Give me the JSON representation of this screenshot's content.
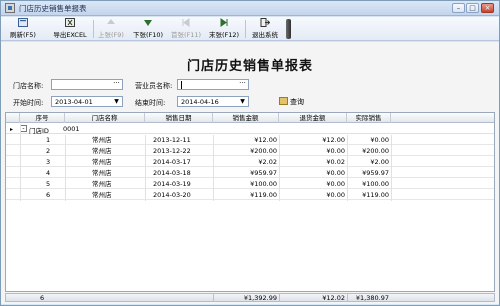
{
  "window": {
    "title": "门店历史销售单报表",
    "minimize": "–",
    "maximize": "□",
    "close": "×"
  },
  "toolbar": {
    "refresh": "刷新(F5)",
    "export_excel": "导出EXCEL",
    "prev_page": "上张(F9)",
    "next_page": "下张(F10)",
    "first_page": "首张(F11)",
    "last_page": "末张(F12)",
    "exit": "退出系统"
  },
  "report": {
    "title": "门店历史销售单报表"
  },
  "filters": {
    "store_label": "门店名称:",
    "store_value": "",
    "clerk_label": "营业员名称:",
    "clerk_value": "",
    "start_label": "开始时间:",
    "start_value": "2013-04-01",
    "end_label": "结束时间:",
    "end_value": "2014-04-16",
    "query_label": "查询",
    "dots": "···",
    "dropdown": "▼"
  },
  "grid": {
    "columns": [
      "序号",
      "门店名称",
      "销售日期",
      "销售金额",
      "退货金额",
      "实际销售"
    ],
    "group": {
      "toggle": "-",
      "label": "门店ID",
      "value": "0001",
      "indicator": "▸"
    },
    "rows": [
      {
        "no": "1",
        "store": "常州店",
        "date": "2013-12-11",
        "sales": "¥12.00",
        "returns": "¥12.00",
        "actual": "¥0.00"
      },
      {
        "no": "2",
        "store": "常州店",
        "date": "2013-12-22",
        "sales": "¥200.00",
        "returns": "¥0.00",
        "actual": "¥200.00"
      },
      {
        "no": "3",
        "store": "常州店",
        "date": "2014-03-17",
        "sales": "¥2.02",
        "returns": "¥0.02",
        "actual": "¥2.00"
      },
      {
        "no": "4",
        "store": "常州店",
        "date": "2014-03-18",
        "sales": "¥959.97",
        "returns": "¥0.00",
        "actual": "¥959.97"
      },
      {
        "no": "5",
        "store": "常州店",
        "date": "2014-03-19",
        "sales": "¥100.00",
        "returns": "¥0.00",
        "actual": "¥100.00"
      },
      {
        "no": "6",
        "store": "常州店",
        "date": "2014-03-20",
        "sales": "¥119.00",
        "returns": "¥0.00",
        "actual": "¥119.00"
      }
    ]
  },
  "summary": {
    "count": "6",
    "sales": "¥1,392.99",
    "returns": "¥12.02",
    "actual": "¥1,380.97"
  }
}
